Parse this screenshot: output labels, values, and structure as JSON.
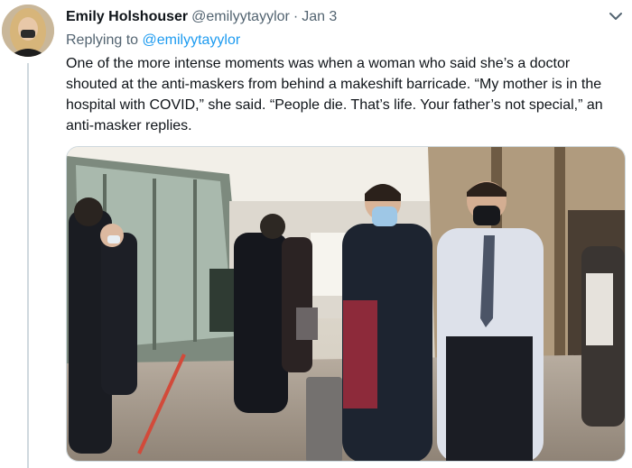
{
  "tweet": {
    "author_name": "Emily Holshouser",
    "author_handle": "@emilyytayylor",
    "separator": "·",
    "date": "Jan 3",
    "replying_prefix": "Replying to",
    "reply_handle": "@emilyytayylor",
    "text": "One of the more intense moments was when a woman who said she’s a doctor shouted at the anti-maskers from behind a makeshift barricade. “My mother is in the hospital with COVID,” she said. “People die. That’s life. Your father’s not special,” an anti-masker replies.",
    "more_icon": "chevron-down-icon",
    "media_icon": "video-still"
  },
  "colors": {
    "name": "#0f1419",
    "secondary": "#536471",
    "link": "#1d9bf0",
    "thread_line": "#cfd9de"
  }
}
